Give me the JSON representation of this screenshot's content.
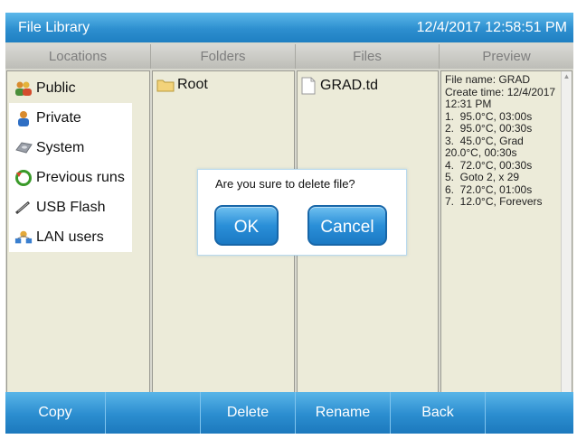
{
  "titlebar": {
    "title": "File Library",
    "clock": "12/4/2017 12:58:51 PM"
  },
  "columns": {
    "locations": "Locations",
    "folders": "Folders",
    "files": "Files",
    "preview": "Preview"
  },
  "locations": [
    {
      "label": "Public",
      "icon": "users-icon"
    },
    {
      "label": "Private",
      "icon": "user-icon"
    },
    {
      "label": "System",
      "icon": "disk-icon"
    },
    {
      "label": "Previous runs",
      "icon": "refresh-icon"
    },
    {
      "label": "USB Flash",
      "icon": "usb-icon"
    },
    {
      "label": "LAN users",
      "icon": "network-icon"
    }
  ],
  "folders": [
    {
      "label": "Root",
      "icon": "folder-icon"
    }
  ],
  "files": [
    {
      "label": "GRAD.td",
      "icon": "file-icon"
    }
  ],
  "preview": {
    "text": "File name: GRAD\nCreate time: 12/4/2017\n12:31 PM\n1.  95.0°C, 03:00s\n2.  95.0°C, 00:30s\n3.  45.0°C, Grad\n20.0°C, 00:30s\n4.  72.0°C, 00:30s\n5.  Goto 2, x 29\n6.  72.0°C, 01:00s\n7.  12.0°C, Forevers"
  },
  "dialog": {
    "message": "Are you sure to delete file?",
    "ok": "OK",
    "cancel": "Cancel"
  },
  "toolbar": {
    "copy": "Copy",
    "delete": "Delete",
    "rename": "Rename",
    "back": "Back"
  },
  "colors": {
    "accent": "#2d8fcf",
    "pane": "#ecebd9",
    "header": "#c9c9c3"
  }
}
